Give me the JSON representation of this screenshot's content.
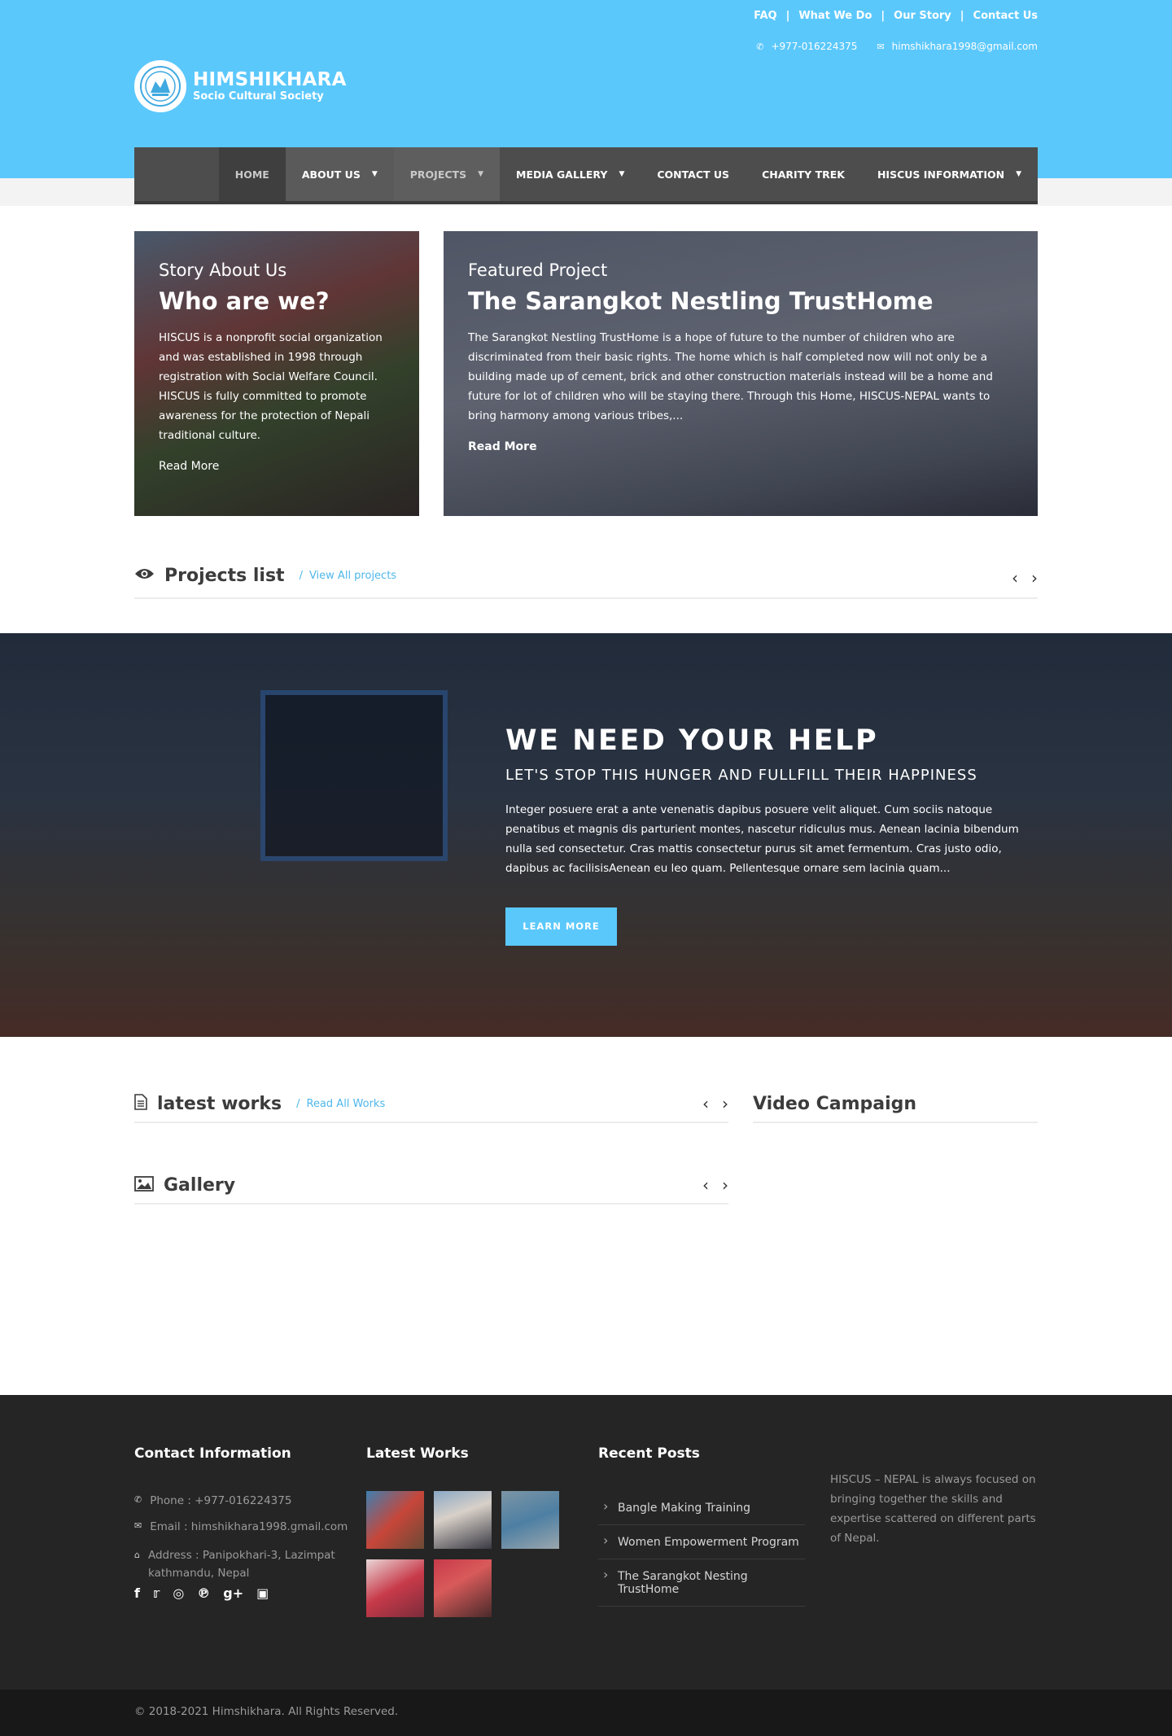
{
  "top_links": [
    "FAQ",
    "What We Do",
    "Our Story",
    "Contact Us"
  ],
  "top_sep": "|",
  "contact": {
    "phone": "+977-016224375",
    "email": "himshikhara1998@gmail.com"
  },
  "logo": {
    "line1": "HIMSHIKHARA",
    "line2": "Socio Cultural Society"
  },
  "nav": [
    {
      "label": "HOME",
      "dropdown": false
    },
    {
      "label": "ABOUT US",
      "dropdown": true
    },
    {
      "label": "PROJECTS",
      "dropdown": true
    },
    {
      "label": "MEDIA GALLERY",
      "dropdown": true
    },
    {
      "label": "CONTACT US",
      "dropdown": false
    },
    {
      "label": "CHARITY TREK",
      "dropdown": false
    },
    {
      "label": "HISCUS INFORMATION",
      "dropdown": true
    }
  ],
  "story": {
    "sub": "Story About Us",
    "title": "Who are we?",
    "body": "HISCUS is a nonprofit social organization and was established in 1998 through registration with Social Welfare Council. HISCUS is fully committed to promote awareness for the protection of Nepali traditional culture.",
    "more": "Read More"
  },
  "featured": {
    "sub": "Featured Project",
    "title": "The Sarangkot Nestling TrustHome",
    "body": "The Sarangkot Nestling TrustHome is a hope of future to the number of children who are discriminated from their basic rights. The home which is half completed now will not only be a building made up of cement, brick and other construction materials instead will be a home and future for lot of children who will be staying there. Through this Home, HISCUS-NEPAL wants to bring harmony among various tribes,...",
    "more": "Read More"
  },
  "projects_list": {
    "title": "Projects list",
    "slash": "/",
    "link": "View All projects"
  },
  "hero": {
    "title": "WE NEED YOUR HELP",
    "subtitle": "LET'S STOP THIS HUNGER AND FULLFILL THEIR HAPPINESS",
    "body": "Integer posuere erat a ante venenatis dapibus posuere velit aliquet. Cum sociis natoque penatibus et magnis dis parturient montes, nascetur ridiculus mus. Aenean lacinia bibendum nulla sed consectetur. Cras mattis consectetur purus sit amet fermentum. Cras justo odio, dapibus ac facilisisAenean eu leo quam. Pellentesque ornare sem lacinia quam...",
    "button": "LEARN MORE"
  },
  "latest_works": {
    "title": "latest works",
    "slash": "/",
    "link": "Read All Works"
  },
  "gallery": {
    "title": "Gallery"
  },
  "video": {
    "title": "Video Campaign"
  },
  "footer": {
    "contact_title": "Contact Information",
    "phone": "Phone : +977-016224375",
    "email": "Email : himshikhara1998.gmail.com",
    "address": "Address : Panipokhari-3, Lazimpat kathmandu, Nepal",
    "works_title": "Latest Works",
    "posts_title": "Recent Posts",
    "posts": [
      "Bangle Making Training",
      "Women Empowerment Program",
      "The Sarangkot Nesting TrustHome"
    ],
    "about": "HISCUS – NEPAL is always focused on bringing together the skills and expertise scattered on different parts of Nepal."
  },
  "social_icons": [
    "facebook-icon",
    "twitter-icon",
    "dribbble-icon",
    "pinterest-icon",
    "google-plus-icon",
    "instagram-icon"
  ],
  "copyright": "© 2018-2021 Himshikhara. All Rights Reserved.",
  "colors": {
    "accent": "#5bc8fc",
    "nav": "#4d4d4d",
    "footer": "#252525",
    "link": "#4fb7ea"
  }
}
